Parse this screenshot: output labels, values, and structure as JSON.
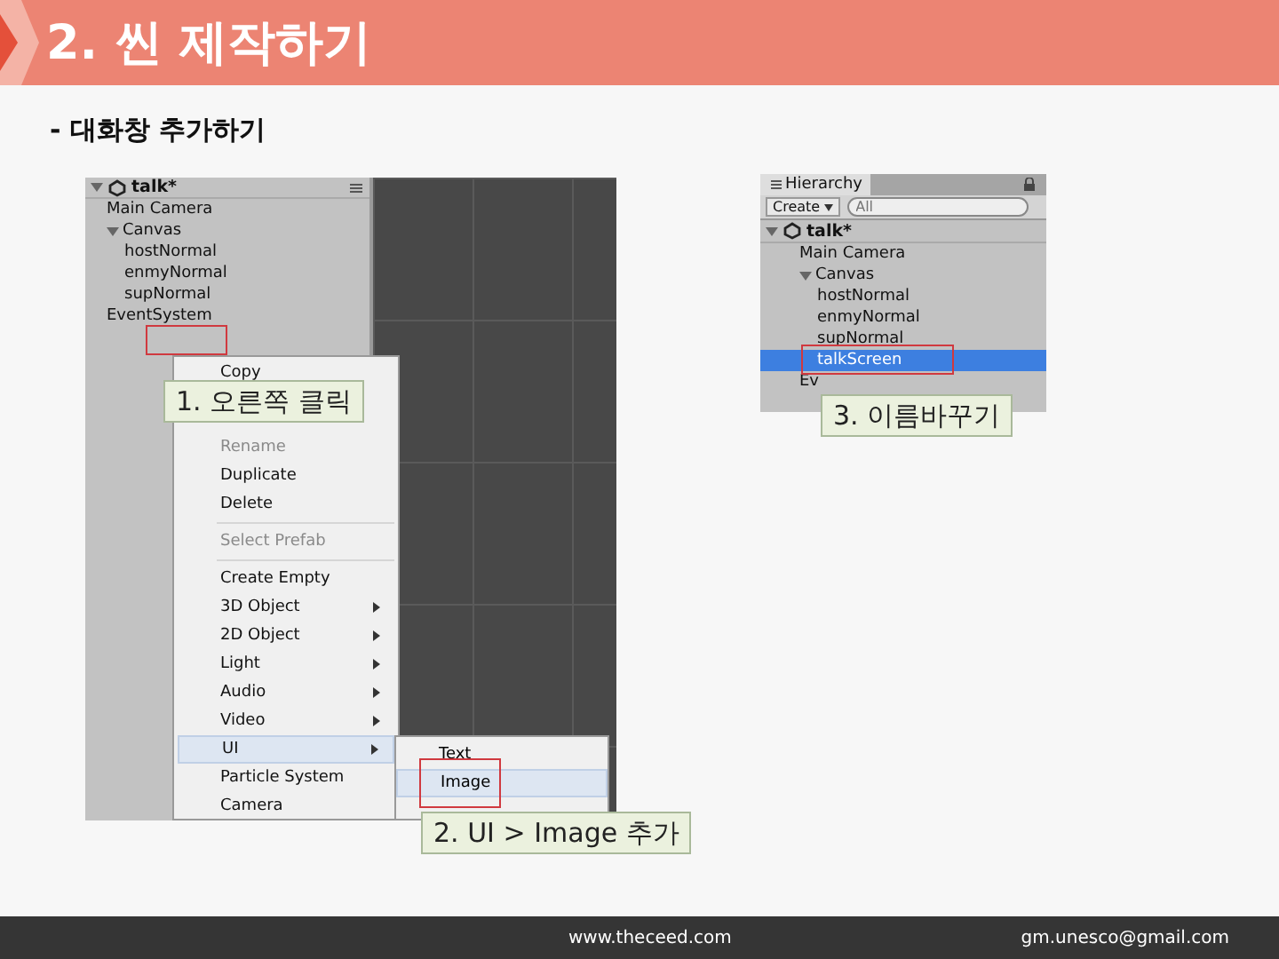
{
  "header": {
    "title": "2. 씬 제작하기"
  },
  "subtitle": "- 대화창 추가하기",
  "left_shot": {
    "scene_name": "talk*",
    "tree": [
      {
        "label": "Main Camera"
      },
      {
        "label": "Canvas",
        "expanded": true,
        "children": [
          {
            "label": "hostNormal"
          },
          {
            "label": "enmyNormal"
          },
          {
            "label": "supNormal"
          }
        ]
      },
      {
        "label": "EventSystem"
      }
    ],
    "context_menu": [
      {
        "kind": "item",
        "label": "Copy",
        "disabled": false,
        "selected": false
      },
      {
        "kind": "gap"
      },
      {
        "kind": "item",
        "label": "Rename",
        "disabled": true,
        "selected": false
      },
      {
        "kind": "item",
        "label": "Duplicate",
        "disabled": false,
        "selected": false
      },
      {
        "kind": "item",
        "label": "Delete",
        "disabled": false,
        "selected": false
      },
      {
        "kind": "separator"
      },
      {
        "kind": "item",
        "label": "Select Prefab",
        "disabled": true,
        "selected": false
      },
      {
        "kind": "separator"
      },
      {
        "kind": "item",
        "label": "Create Empty",
        "disabled": false,
        "selected": false
      },
      {
        "kind": "submenu",
        "label": "3D Object",
        "disabled": false,
        "selected": false
      },
      {
        "kind": "submenu",
        "label": "2D Object",
        "disabled": false,
        "selected": false
      },
      {
        "kind": "submenu",
        "label": "Light",
        "disabled": false,
        "selected": false
      },
      {
        "kind": "submenu",
        "label": "Audio",
        "disabled": false,
        "selected": false
      },
      {
        "kind": "submenu",
        "label": "Video",
        "disabled": false,
        "selected": false
      },
      {
        "kind": "submenu",
        "label": "UI",
        "disabled": false,
        "selected": true
      },
      {
        "kind": "item",
        "label": "Particle System",
        "disabled": false,
        "selected": false
      },
      {
        "kind": "item",
        "label": "Camera",
        "disabled": false,
        "selected": false
      }
    ],
    "submenu": [
      {
        "label": "Text",
        "selected": false
      },
      {
        "label": "Image",
        "selected": true
      }
    ]
  },
  "right_shot": {
    "panel_title": "Hierarchy",
    "create_button": "Create",
    "search_placeholder": "All",
    "scene_name": "talk*",
    "tree": [
      {
        "label": "Main Camera",
        "selected": false
      },
      {
        "label": "Canvas",
        "expanded": true,
        "selected": false,
        "children": [
          {
            "label": "hostNormal",
            "selected": false
          },
          {
            "label": "enmyNormal",
            "selected": false
          },
          {
            "label": "supNormal",
            "selected": false
          },
          {
            "label": "talkScreen",
            "selected": true
          }
        ]
      },
      {
        "label": "Ev",
        "selected": false
      }
    ]
  },
  "callouts": [
    "1. 오른쪽 클릭",
    "2. UI > Image 추가",
    "3. 이름바꾸기"
  ],
  "footer": {
    "website": "www.theceed.com",
    "email": "gm.unesco@gmail.com"
  }
}
